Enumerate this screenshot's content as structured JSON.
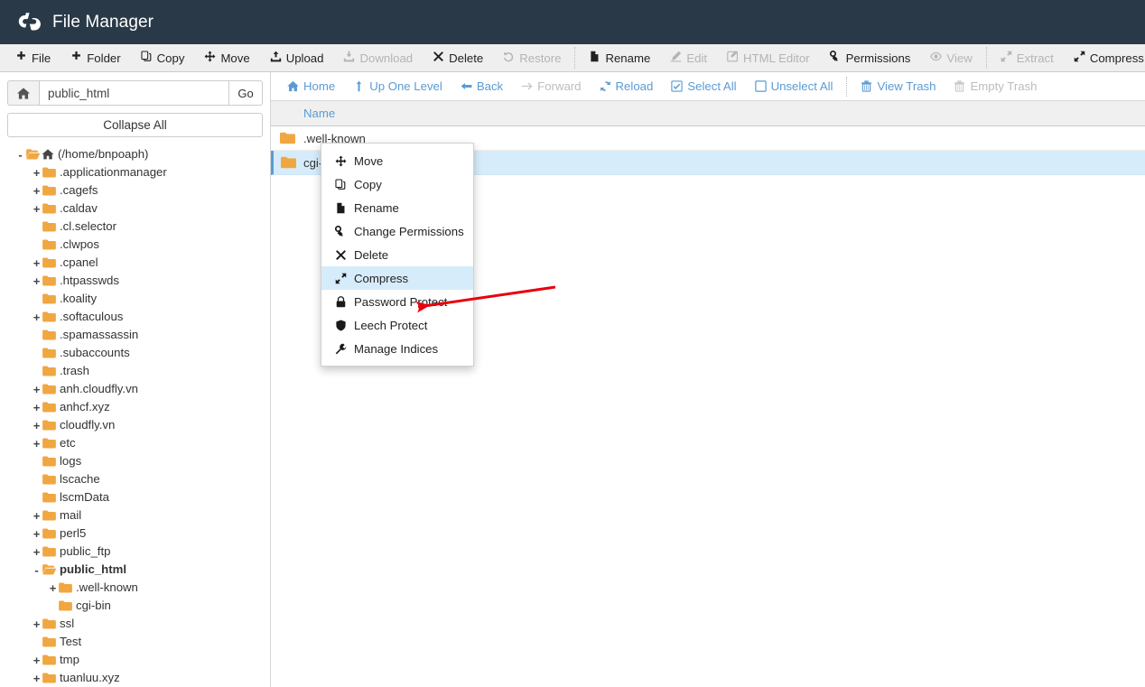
{
  "header": {
    "title": "File Manager",
    "logo_icon": "cpanel-logo-icon",
    "bg_color": "#293947"
  },
  "toolbar": {
    "items": [
      {
        "label": "File",
        "icon": "plus-icon",
        "disabled": false
      },
      {
        "label": "Folder",
        "icon": "plus-icon",
        "disabled": false
      },
      {
        "label": "Copy",
        "icon": "copy-icon",
        "disabled": false
      },
      {
        "label": "Move",
        "icon": "move-arrows-icon",
        "disabled": false
      },
      {
        "label": "Upload",
        "icon": "upload-icon",
        "disabled": false
      },
      {
        "label": "Download",
        "icon": "download-icon",
        "disabled": true
      },
      {
        "label": "Delete",
        "icon": "x-cross-icon",
        "disabled": false
      },
      {
        "label": "Restore",
        "icon": "undo-icon",
        "disabled": true
      },
      {
        "label": "Rename",
        "icon": "file-page-icon",
        "disabled": false
      },
      {
        "label": "Edit",
        "icon": "pencil-icon",
        "disabled": true
      },
      {
        "label": "HTML Editor",
        "icon": "edit-box-icon",
        "disabled": true
      },
      {
        "label": "Permissions",
        "icon": "key-icon",
        "disabled": false
      },
      {
        "label": "View",
        "icon": "eye-icon",
        "disabled": true
      },
      {
        "label": "Extract",
        "icon": "expand-icon",
        "disabled": true
      },
      {
        "label": "Compress",
        "icon": "compress-icon",
        "disabled": false
      }
    ],
    "separator_after": [
      7,
      12
    ]
  },
  "sidebar": {
    "path_input": {
      "value": "public_html",
      "placeholder": ""
    },
    "home_icon": "home-icon",
    "go_label": "Go",
    "collapse_all_label": "Collapse All",
    "tree": [
      {
        "label": "(/home/bnpoaph)",
        "depth": 0,
        "toggle": "-",
        "icon": "home-folder-icon",
        "bold": false
      },
      {
        "label": ".applicationmanager",
        "depth": 1,
        "toggle": "+",
        "icon": "folder-icon",
        "bold": false
      },
      {
        "label": ".cagefs",
        "depth": 1,
        "toggle": "+",
        "icon": "folder-icon",
        "bold": false
      },
      {
        "label": ".caldav",
        "depth": 1,
        "toggle": "+",
        "icon": "folder-icon",
        "bold": false
      },
      {
        "label": ".cl.selector",
        "depth": 1,
        "toggle": "",
        "icon": "folder-icon",
        "bold": false
      },
      {
        "label": ".clwpos",
        "depth": 1,
        "toggle": "",
        "icon": "folder-icon",
        "bold": false
      },
      {
        "label": ".cpanel",
        "depth": 1,
        "toggle": "+",
        "icon": "folder-icon",
        "bold": false
      },
      {
        "label": ".htpasswds",
        "depth": 1,
        "toggle": "+",
        "icon": "folder-icon",
        "bold": false
      },
      {
        "label": ".koality",
        "depth": 1,
        "toggle": "",
        "icon": "folder-icon",
        "bold": false
      },
      {
        "label": ".softaculous",
        "depth": 1,
        "toggle": "+",
        "icon": "folder-icon",
        "bold": false
      },
      {
        "label": ".spamassassin",
        "depth": 1,
        "toggle": "",
        "icon": "folder-icon",
        "bold": false
      },
      {
        "label": ".subaccounts",
        "depth": 1,
        "toggle": "",
        "icon": "folder-icon",
        "bold": false
      },
      {
        "label": ".trash",
        "depth": 1,
        "toggle": "",
        "icon": "folder-icon",
        "bold": false
      },
      {
        "label": "anh.cloudfly.vn",
        "depth": 1,
        "toggle": "+",
        "icon": "folder-icon",
        "bold": false
      },
      {
        "label": "anhcf.xyz",
        "depth": 1,
        "toggle": "+",
        "icon": "folder-icon",
        "bold": false
      },
      {
        "label": "cloudfly.vn",
        "depth": 1,
        "toggle": "+",
        "icon": "folder-icon",
        "bold": false
      },
      {
        "label": "etc",
        "depth": 1,
        "toggle": "+",
        "icon": "folder-icon",
        "bold": false
      },
      {
        "label": "logs",
        "depth": 1,
        "toggle": "",
        "icon": "folder-icon",
        "bold": false
      },
      {
        "label": "lscache",
        "depth": 1,
        "toggle": "",
        "icon": "folder-icon",
        "bold": false
      },
      {
        "label": "lscmData",
        "depth": 1,
        "toggle": "",
        "icon": "folder-icon",
        "bold": false
      },
      {
        "label": "mail",
        "depth": 1,
        "toggle": "+",
        "icon": "folder-icon",
        "bold": false
      },
      {
        "label": "perl5",
        "depth": 1,
        "toggle": "+",
        "icon": "folder-icon",
        "bold": false
      },
      {
        "label": "public_ftp",
        "depth": 1,
        "toggle": "+",
        "icon": "folder-icon",
        "bold": false
      },
      {
        "label": "public_html",
        "depth": 1,
        "toggle": "-",
        "icon": "folder-open-icon",
        "bold": true
      },
      {
        "label": ".well-known",
        "depth": 2,
        "toggle": "+",
        "icon": "folder-icon",
        "bold": false
      },
      {
        "label": "cgi-bin",
        "depth": 2,
        "toggle": "",
        "icon": "folder-icon",
        "bold": false
      },
      {
        "label": "ssl",
        "depth": 1,
        "toggle": "+",
        "icon": "folder-icon",
        "bold": false
      },
      {
        "label": "Test",
        "depth": 1,
        "toggle": "",
        "icon": "folder-icon",
        "bold": false
      },
      {
        "label": "tmp",
        "depth": 1,
        "toggle": "+",
        "icon": "folder-icon",
        "bold": false
      },
      {
        "label": "tuanluu.xyz",
        "depth": 1,
        "toggle": "+",
        "icon": "folder-icon",
        "bold": false
      }
    ]
  },
  "navbar": {
    "items": [
      {
        "label": "Home",
        "icon": "home-icon",
        "disabled": false
      },
      {
        "label": "Up One Level",
        "icon": "up-arrow-icon",
        "disabled": false
      },
      {
        "label": "Back",
        "icon": "left-arrow-icon",
        "disabled": false
      },
      {
        "label": "Forward",
        "icon": "right-arrow-icon",
        "disabled": true
      },
      {
        "label": "Reload",
        "icon": "reload-icon",
        "disabled": false
      },
      {
        "label": "Select All",
        "icon": "checked-box-icon",
        "disabled": false
      },
      {
        "label": "Unselect All",
        "icon": "empty-box-icon",
        "disabled": false
      },
      {
        "label": "View Trash",
        "icon": "trash-icon",
        "disabled": false
      },
      {
        "label": "Empty Trash",
        "icon": "trash-icon",
        "disabled": true
      }
    ],
    "separator_after": [
      6
    ]
  },
  "file_list": {
    "columns": [
      "Name"
    ],
    "rows": [
      {
        "name": ".well-known",
        "icon": "folder-icon",
        "selected": false
      },
      {
        "name": "cgi-bin",
        "icon": "folder-icon",
        "selected": true
      }
    ]
  },
  "context_menu": {
    "items": [
      {
        "label": "Move",
        "icon": "move-arrows-icon",
        "active": false
      },
      {
        "label": "Copy",
        "icon": "copy-icon",
        "active": false
      },
      {
        "label": "Rename",
        "icon": "file-page-icon",
        "active": false
      },
      {
        "label": "Change Permissions",
        "icon": "key-icon",
        "active": false
      },
      {
        "label": "Delete",
        "icon": "x-cross-icon",
        "active": false
      },
      {
        "label": "Compress",
        "icon": "compress-icon",
        "active": true
      },
      {
        "label": "Password Protect",
        "icon": "lock-icon",
        "active": false
      },
      {
        "label": "Leech Protect",
        "icon": "shield-icon",
        "active": false
      },
      {
        "label": "Manage Indices",
        "icon": "wrench-icon",
        "active": false
      }
    ],
    "highlight_color": "#d7ecfa"
  },
  "annotation": {
    "type": "arrow",
    "color": "#e8000d",
    "points_to": "Compress"
  },
  "colors": {
    "header_bg": "#293947",
    "toolbar_bg": "#efefef",
    "folder_orange": "#f0a741",
    "link_blue": "#5b9bd5",
    "selection_blue": "#d7ecfa"
  }
}
